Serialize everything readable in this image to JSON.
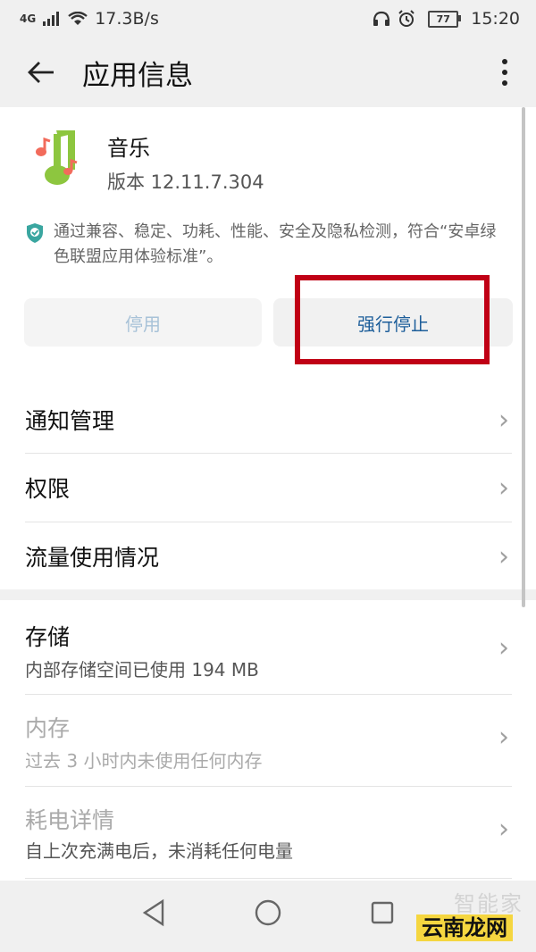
{
  "status_bar": {
    "network": "4G",
    "speed": "17.3B/s",
    "battery": "77",
    "time": "15:20"
  },
  "app_bar": {
    "title": "应用信息"
  },
  "app": {
    "name": "音乐",
    "version": "版本 12.11.7.304",
    "certification": "通过兼容、稳定、功耗、性能、安全及隐私检测，符合“安卓绿色联盟应用体验标准”。"
  },
  "buttons": {
    "disable": "停用",
    "force_stop": "强行停止"
  },
  "menu": [
    {
      "label": "通知管理"
    },
    {
      "label": "权限"
    },
    {
      "label": "流量使用情况"
    }
  ],
  "details": [
    {
      "title": "存储",
      "subtitle": "内部存储空间已使用 194 MB"
    },
    {
      "title": "内存",
      "subtitle": "过去 3 小时内未使用任何内存"
    },
    {
      "title": "耗电详情",
      "subtitle": "自上次充满电后，未消耗任何电量"
    }
  ],
  "watermark": {
    "line1": "智能家",
    "line2": "云南龙网"
  },
  "colors": {
    "highlight": "#c00015",
    "force_stop_text": "#1d5e9a",
    "disabled_text": "#a8c2d8"
  }
}
